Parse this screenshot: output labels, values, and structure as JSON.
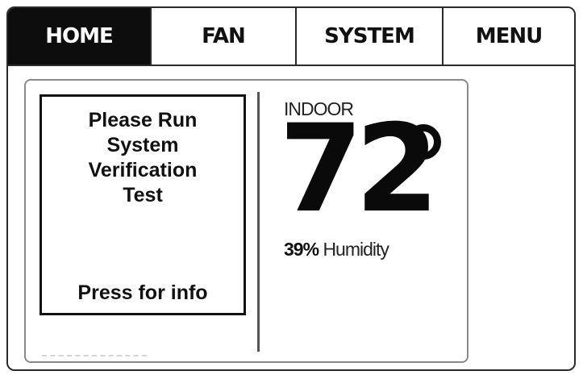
{
  "tabs": [
    {
      "label": "HOME",
      "active": true
    },
    {
      "label": "FAN",
      "active": false
    },
    {
      "label": "SYSTEM",
      "active": false
    },
    {
      "label": "MENU",
      "active": false
    }
  ],
  "message": {
    "text": "Please Run System Verification Test",
    "action": "Press for info"
  },
  "indoor": {
    "label": "INDOOR",
    "temperature": "72",
    "degree_symbol": "°",
    "humidity_value": "39%",
    "humidity_label": "Humidity"
  },
  "colors": {
    "active_tab_bg": "#0d0d0d",
    "active_tab_text": "#ffffff",
    "text": "#111111"
  }
}
